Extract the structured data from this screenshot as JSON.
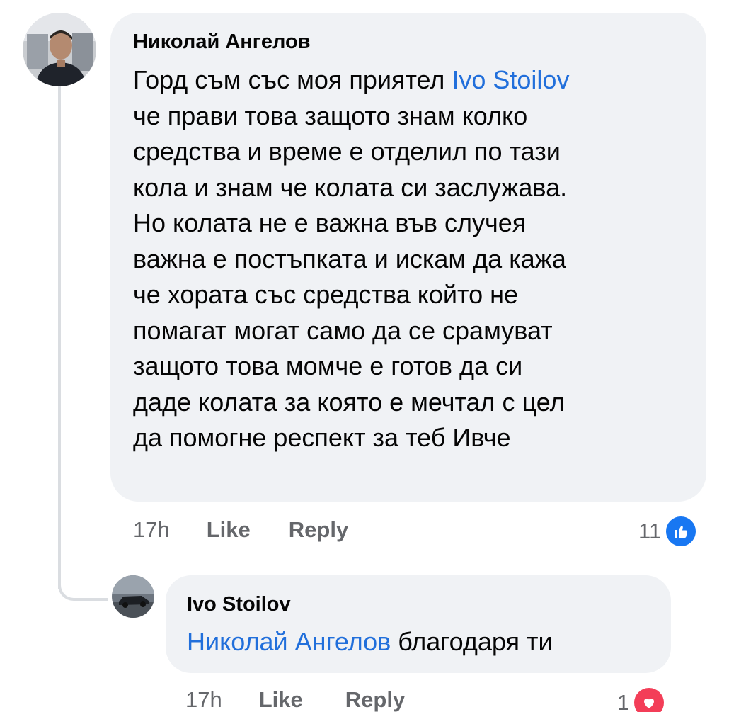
{
  "comment": {
    "author": "Николай Ангелов",
    "avatar_icon": "profile-photo-man-in-car",
    "text_before_mention": "Горд съм със моя приятел ",
    "mention": "Ivo Stoilov",
    "text_after_mention": "\nче прави това защото знам колко\nсредства и време е отделил по тази\nкола и знам че колата си заслужава.\nНо колата не е важна във случея\nважна е постъпката и искам да кажа\nче хората със средства който не\nпомагат могат само да се срамуват\nзащото това момче е готов да си\nдаде колата за която е мечтал с цел\nда помогне респект за теб Ивче",
    "time": "17h",
    "like_label": "Like",
    "reply_label": "Reply",
    "reaction_count": "11",
    "reaction_icon": "like-reaction-icon"
  },
  "reply": {
    "author": "Ivo Stoilov",
    "avatar_icon": "profile-photo-dark-car",
    "mention": "Николай Ангелов",
    "text": " благодаря ти",
    "time": "17h",
    "like_label": "Like",
    "reply_label": "Reply",
    "reaction_count": "1",
    "reaction_icon": "love-reaction-icon"
  },
  "colors": {
    "bubble": "#f0f2f5",
    "mention": "#216fdb",
    "meta": "#65676b",
    "like_blue": "#1877f2",
    "love_red": "#f33e58"
  }
}
